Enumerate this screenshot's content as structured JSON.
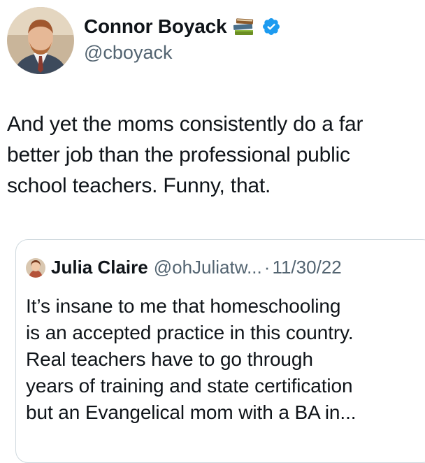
{
  "author": {
    "display_name": "Connor Boyack",
    "handle": "@cboyack",
    "name_emoji": "books-icon",
    "verified_icon": "verified-badge-icon",
    "verified_color": "#1d9bf0"
  },
  "tweet": {
    "text_lines": [
      "And yet the moms consistently do a far",
      "better job than the professional public",
      "school teachers. Funny, that."
    ]
  },
  "quoted_tweet": {
    "display_name": "Julia Claire",
    "handle": "@ohJuliatw...",
    "separator": "·",
    "date": "11/30/22",
    "text_lines": [
      "It’s insane to me that homeschooling",
      "is an accepted practice in this country.",
      "Real teachers have to go through",
      "years of training and state certification",
      "but an Evangelical mom with a BA in..."
    ]
  },
  "colors": {
    "text": "#0f1419",
    "secondary_text": "#536471",
    "border": "#cfd9de"
  }
}
